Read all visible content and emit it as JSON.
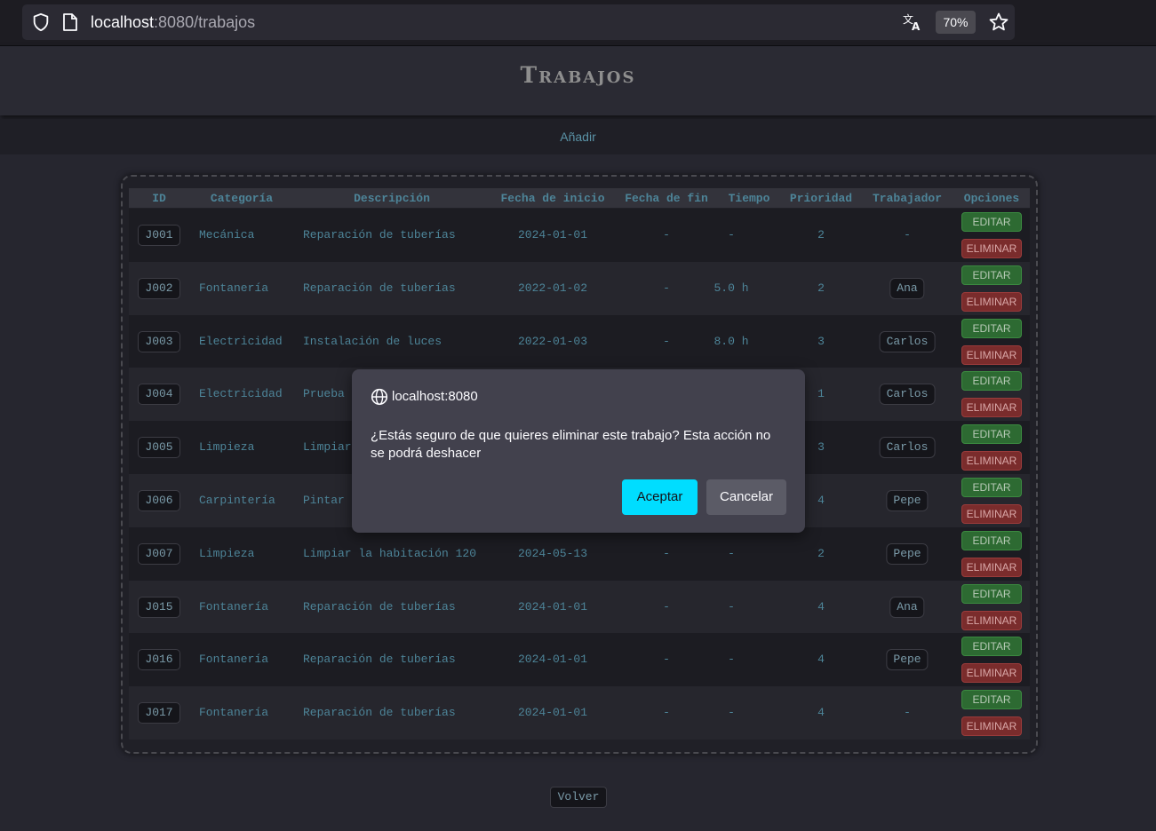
{
  "browser": {
    "url_host": "localhost",
    "url_path": ":8080/trabajos",
    "zoom": "70%"
  },
  "page": {
    "title": "Trabajos",
    "nav_add": "Añadir",
    "back_label": "Volver"
  },
  "table": {
    "headers": [
      "ID",
      "Categoría",
      "Descripción",
      "Fecha de inicio",
      "Fecha de fin",
      "Tiempo",
      "Prioridad",
      "Trabajador",
      "Opciones"
    ],
    "edit_label": "EDITAR",
    "delete_label": "ELIMINAR",
    "rows": [
      {
        "id": "J001",
        "categoria": "Mecánica",
        "descripcion": "Reparación de tuberías",
        "inicio": "2024-01-01",
        "fin": "-",
        "tiempo": "-",
        "prioridad": "2",
        "trabajador": "-"
      },
      {
        "id": "J002",
        "categoria": "Fontanería",
        "descripcion": "Reparación de tuberías",
        "inicio": "2022-01-02",
        "fin": "-",
        "tiempo": "5.0 h",
        "prioridad": "2",
        "trabajador": "Ana"
      },
      {
        "id": "J003",
        "categoria": "Electricidad",
        "descripcion": "Instalación de luces",
        "inicio": "2022-01-03",
        "fin": "-",
        "tiempo": "8.0 h",
        "prioridad": "3",
        "trabajador": "Carlos"
      },
      {
        "id": "J004",
        "categoria": "Electricidad",
        "descripcion": "Prueba",
        "inicio": "",
        "fin": "",
        "tiempo": "",
        "prioridad": "1",
        "trabajador": "Carlos"
      },
      {
        "id": "J005",
        "categoria": "Limpieza",
        "descripcion": "Limpiar",
        "inicio": "",
        "fin": "",
        "tiempo": "",
        "prioridad": "3",
        "trabajador": "Carlos"
      },
      {
        "id": "J006",
        "categoria": "Carpintería",
        "descripcion": "Pintar",
        "inicio": "",
        "fin": "",
        "tiempo": "",
        "prioridad": "4",
        "trabajador": "Pepe"
      },
      {
        "id": "J007",
        "categoria": "Limpieza",
        "descripcion": "Limpiar la habitación 120",
        "inicio": "2024-05-13",
        "fin": "-",
        "tiempo": "-",
        "prioridad": "2",
        "trabajador": "Pepe"
      },
      {
        "id": "J015",
        "categoria": "Fontanería",
        "descripcion": "Reparación de tuberías",
        "inicio": "2024-01-01",
        "fin": "-",
        "tiempo": "-",
        "prioridad": "4",
        "trabajador": "Ana"
      },
      {
        "id": "J016",
        "categoria": "Fontanería",
        "descripcion": "Reparación de tuberías",
        "inicio": "2024-01-01",
        "fin": "-",
        "tiempo": "-",
        "prioridad": "4",
        "trabajador": "Pepe"
      },
      {
        "id": "J017",
        "categoria": "Fontanería",
        "descripcion": "Reparación de tuberías",
        "inicio": "2024-01-01",
        "fin": "-",
        "tiempo": "-",
        "prioridad": "4",
        "trabajador": "-"
      }
    ]
  },
  "dialog": {
    "origin": "localhost:8080",
    "message": "¿Estás seguro de que quieres eliminar este trabajo? Esta acción no se podrá deshacer",
    "accept_label": "Aceptar",
    "cancel_label": "Cancelar"
  },
  "colors": {
    "accent": "#00ddff",
    "edit": "#2d6a32",
    "delete": "#7a2c2c",
    "text": "#4d8498"
  }
}
